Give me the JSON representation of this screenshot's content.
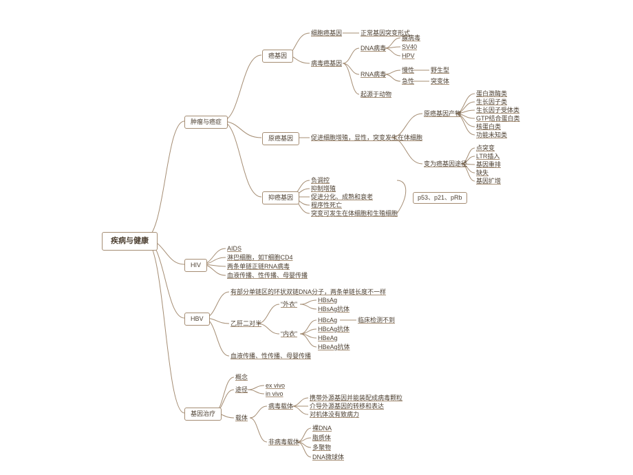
{
  "root": "疾病与健康",
  "b1": "肿瘤与癌症",
  "b2": "HIV",
  "b3": "HBV",
  "b4": "基因治疗",
  "t_oncogene": "癌基因",
  "t_proto": "原癌基因",
  "t_suppressor": "抑癌基因",
  "oc1": "细胞癌基因",
  "oc1a": "正常基因突变形式",
  "oc2": "病毒癌基因",
  "oc2a": "DNA病毒",
  "oc2b": "RNA病毒",
  "oc2c": "起源于动物",
  "dna1": "腺病毒",
  "dna2": "SV40",
  "dna3": "HPV",
  "rna1": "慢性",
  "rna1a": "野生型",
  "rna2": "急性",
  "rna2a": "突变体",
  "proto_note": "促进细胞增殖，显性，突变发生在体细胞",
  "proto_p": "原癌基因产物",
  "pp1": "蛋白激酶类",
  "pp2": "生长因子类",
  "pp3": "生长因子受体类",
  "pp4": "GTP结合蛋白类",
  "pp5": "核蛋白类",
  "pp6": "功能未知类",
  "proto_m": "变为癌基因途径",
  "pm1": "点突变",
  "pm2": "LTR插入",
  "pm3": "基因重排",
  "pm4": "缺失",
  "pm5": "基因扩增",
  "sup1": "负调控",
  "sup2": "抑制增殖",
  "sup3": "促进分化、成熟和衰老",
  "sup4": "程序性死亡",
  "sup5": "突变可发生在体细胞和生殖细胞",
  "sup_annot": "p53、p21、pRb",
  "hiv1": "AIDS",
  "hiv2": "淋巴细胞，如T细胞CD4",
  "hiv3": "两条单链正链RNA病毒",
  "hiv4": "血液传播、性传播、母婴传播",
  "hbv1": "有部分单链区的环状双链DNA分子，两条单链长度不一样",
  "hbv2": "乙肝二对半",
  "hbv3": "血液传播、性传播、母婴传播",
  "hbv_o": "“外衣”",
  "o1": "HBsAg",
  "o2": "HBsAg抗体",
  "hbv_i": "“内衣”",
  "i1": "HBcAg",
  "i1a": "临床检测不到",
  "i2": "HBcAg抗体",
  "i3": "HBeAg",
  "i4": "HBeAg抗体",
  "gt1": "概念",
  "gt2": "途径",
  "gt2a": "ex vivo",
  "gt2b": "in vivo",
  "gt3": "载体",
  "gt3a": "病毒载体",
  "va1": "携带外源基因并能装配成病毒颗粒",
  "va2": "介导外源基因的转移和表达",
  "va3": "对机体没有致病力",
  "gt3b": "非病毒载体",
  "nv1": "裸DNA",
  "nv2": "脂质体",
  "nv3": "多聚物",
  "nv4": "DNA微球体"
}
